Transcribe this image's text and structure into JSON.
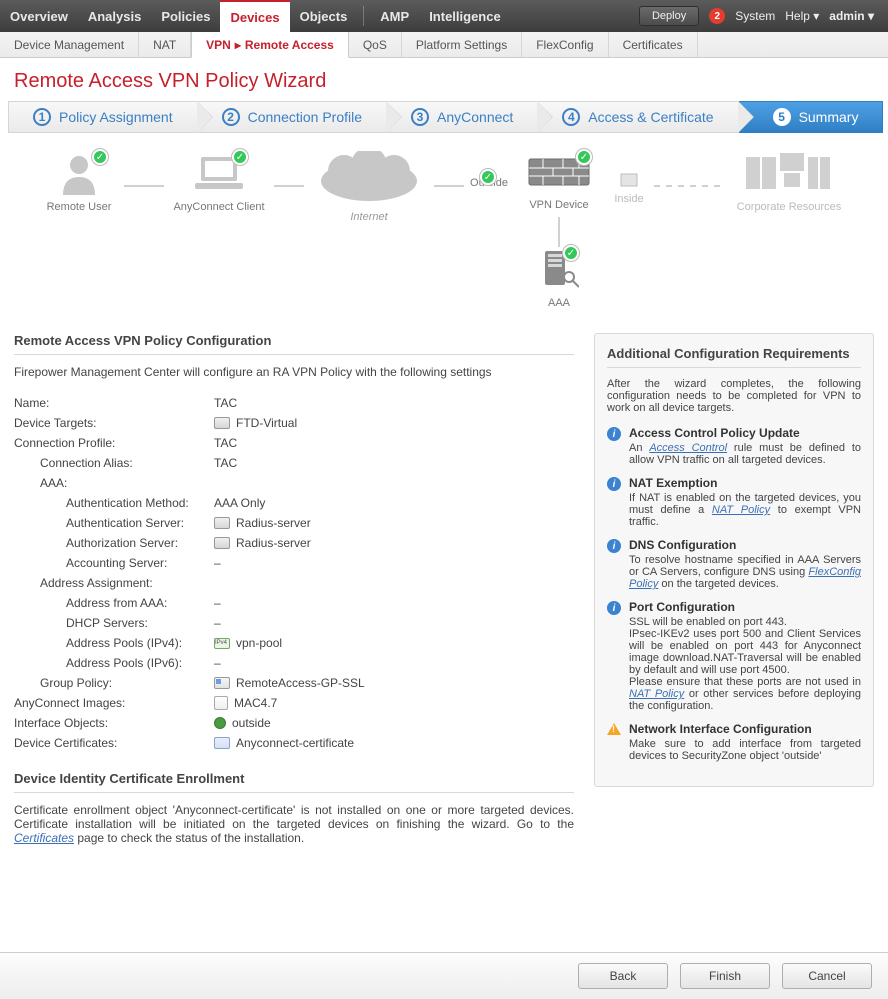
{
  "topnav": {
    "items": [
      "Overview",
      "Analysis",
      "Policies",
      "Devices",
      "Objects",
      "AMP",
      "Intelligence"
    ],
    "activeIndex": 3,
    "deploy": "Deploy",
    "alertCount": "2",
    "system": "System",
    "help": "Help ▾",
    "user": "admin ▾"
  },
  "subtabs": {
    "items": [
      "Device Management",
      "NAT",
      "VPN ▸ Remote Access",
      "QoS",
      "Platform Settings",
      "FlexConfig",
      "Certificates"
    ],
    "activeIndex": 2
  },
  "wizardTitle": "Remote Access VPN Policy Wizard",
  "steps": [
    {
      "n": "1",
      "label": "Policy Assignment"
    },
    {
      "n": "2",
      "label": "Connection Profile"
    },
    {
      "n": "3",
      "label": "AnyConnect"
    },
    {
      "n": "4",
      "label": "Access & Certificate"
    },
    {
      "n": "5",
      "label": "Summary"
    }
  ],
  "activeStep": 4,
  "topo": {
    "remoteUser": "Remote User",
    "anyconnect": "AnyConnect Client",
    "internet": "Internet",
    "outside": "Outside",
    "vpnDevice": "VPN Device",
    "inside": "Inside",
    "corp": "Corporate Resources",
    "aaa": "AAA"
  },
  "leftTitle": "Remote Access VPN Policy Configuration",
  "leftIntro": "Firepower Management Center will configure an RA VPN Policy with the following settings",
  "fields": {
    "name": {
      "k": "Name:",
      "v": "TAC"
    },
    "targets": {
      "k": "Device Targets:",
      "v": "FTD-Virtual"
    },
    "connProfile": {
      "k": "Connection Profile:",
      "v": "TAC"
    },
    "connAlias": {
      "k": "Connection Alias:",
      "v": "TAC"
    },
    "aaa": {
      "k": "AAA:"
    },
    "authMethod": {
      "k": "Authentication Method:",
      "v": "AAA Only"
    },
    "authnServer": {
      "k": "Authentication Server:",
      "v": "Radius-server"
    },
    "authzServer": {
      "k": "Authorization Server:",
      "v": "Radius-server"
    },
    "acctServer": {
      "k": "Accounting Server:",
      "v": "–"
    },
    "addrAssign": {
      "k": "Address Assignment:"
    },
    "addrAAA": {
      "k": "Address from AAA:",
      "v": "–"
    },
    "dhcp": {
      "k": "DHCP Servers:",
      "v": "–"
    },
    "pool4": {
      "k": "Address Pools (IPv4):",
      "v": "vpn-pool"
    },
    "pool6": {
      "k": "Address Pools (IPv6):",
      "v": "–"
    },
    "gp": {
      "k": "Group Policy:",
      "v": "RemoteAccess-GP-SSL"
    },
    "acImg": {
      "k": "AnyConnect Images:",
      "v": "MAC4.7"
    },
    "ifObj": {
      "k": "Interface Objects:",
      "v": "outside"
    },
    "devCert": {
      "k": "Device Certificates:",
      "v": "Anyconnect-certificate"
    }
  },
  "enroll": {
    "title": "Device Identity Certificate Enrollment",
    "text1": "Certificate enrollment object 'Anyconnect-certificate' is not installed on one or more targeted devices. Certificate installation will be initiated on the targeted devices on finishing the wizard. Go to the ",
    "link": "Certificates",
    "text2": " page to check the status of the installation."
  },
  "rightTitle": "Additional Configuration Requirements",
  "rightIntro": "After the wizard completes, the following configuration needs to be completed for VPN to work on all device targets.",
  "reqs": [
    {
      "icon": "info",
      "title": "Access Control Policy Update",
      "body1": "An ",
      "link": "Access Control",
      "body2": " rule must be defined to allow VPN traffic on all targeted devices."
    },
    {
      "icon": "info",
      "title": "NAT Exemption",
      "body1": "If NAT is enabled on the targeted devices, you must define a ",
      "link": "NAT Policy",
      "body2": " to exempt VPN traffic."
    },
    {
      "icon": "info",
      "title": "DNS Configuration",
      "body1": "To resolve hostname specified in AAA Servers or CA Servers, configure DNS using ",
      "link": "FlexConfig Policy",
      "body2": " on the targeted devices."
    },
    {
      "icon": "info",
      "title": "Port Configuration",
      "body1": "SSL will be enabled on port 443.\nIPsec-IKEv2 uses port 500 and Client Services will be enabled on port 443 for Anyconnect image download.NAT-Traversal will be enabled by default and will use port 4500.\nPlease ensure that these ports are not used in ",
      "link": "NAT Policy",
      "body2": " or other services before deploying the configuration."
    },
    {
      "icon": "warn",
      "title": "Network Interface Configuration",
      "body1": "Make sure to add interface from targeted devices to SecurityZone object 'outside'",
      "link": "",
      "body2": ""
    }
  ],
  "footer": {
    "back": "Back",
    "finish": "Finish",
    "cancel": "Cancel"
  }
}
